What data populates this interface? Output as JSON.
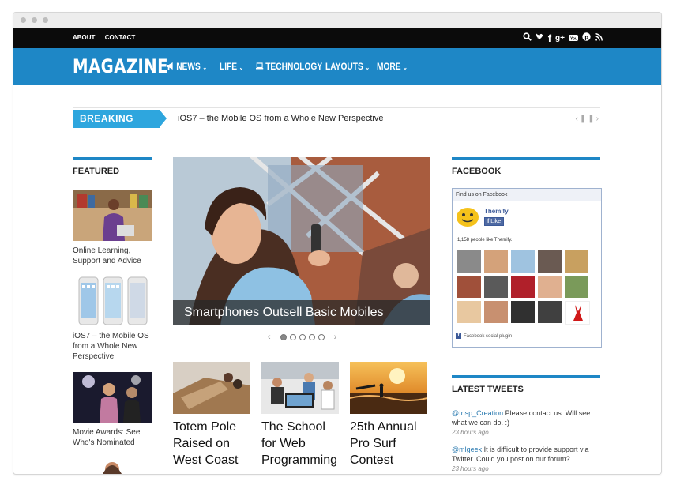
{
  "topbar": {
    "links": [
      "ABOUT",
      "CONTACT"
    ]
  },
  "social_icons": [
    "search-icon",
    "twitter-icon",
    "facebook-icon",
    "google-plus-icon",
    "youtube-icon",
    "pinterest-icon",
    "rss-icon"
  ],
  "header": {
    "logo": "MAGAZINE",
    "nav": [
      {
        "label": "NEWS",
        "icon": "megaphone-icon",
        "dropdown": true
      },
      {
        "label": "LIFE",
        "dropdown": true
      },
      {
        "label": "TECHNOLOGY",
        "icon": "laptop-icon",
        "dropdown": false
      },
      {
        "label": "LAYOUTS",
        "dropdown": true
      },
      {
        "label": "MORE",
        "dropdown": true
      }
    ]
  },
  "breaking": {
    "label": "BREAKING NEWS",
    "headline": "iOS7 – the Mobile OS from a Whole New Perspective"
  },
  "featured": {
    "heading": "FEATURED",
    "items": [
      {
        "title": "Online Learning, Support and Advice"
      },
      {
        "title": "iOS7 – the Mobile OS from a Whole New Perspective"
      },
      {
        "title": "Movie Awards: See Who's Nominated"
      }
    ]
  },
  "slider": {
    "caption": "Smartphones Outsell Basic Mobiles",
    "slides": 5,
    "active": 1
  },
  "posts": [
    {
      "title": "Totem Pole Raised on West Coast"
    },
    {
      "title": "The School for Web Programming"
    },
    {
      "title": "25th Annual Pro Surf Contest"
    }
  ],
  "facebook": {
    "heading": "FACEBOOK",
    "box_title": "Find us on Facebook",
    "page_name": "Themify",
    "like": "Like",
    "count_text": "1,158 people like Themify.",
    "plugin_text": "Facebook social plugin"
  },
  "tweets": {
    "heading": "LATEST TWEETS",
    "items": [
      {
        "handle": "@Insp_Creation",
        "text": " Please contact us. Will see what we can do. :)",
        "time": "23 hours ago"
      },
      {
        "handle": "@mlgeek",
        "text": " It is difficult to provide support via Twitter. Could you post on our forum?",
        "time": "23 hours ago"
      }
    ]
  },
  "colors": {
    "brand_blue": "#1e87c6",
    "breaking_blue": "#2ea6de",
    "topbar": "#0b0b0b"
  }
}
